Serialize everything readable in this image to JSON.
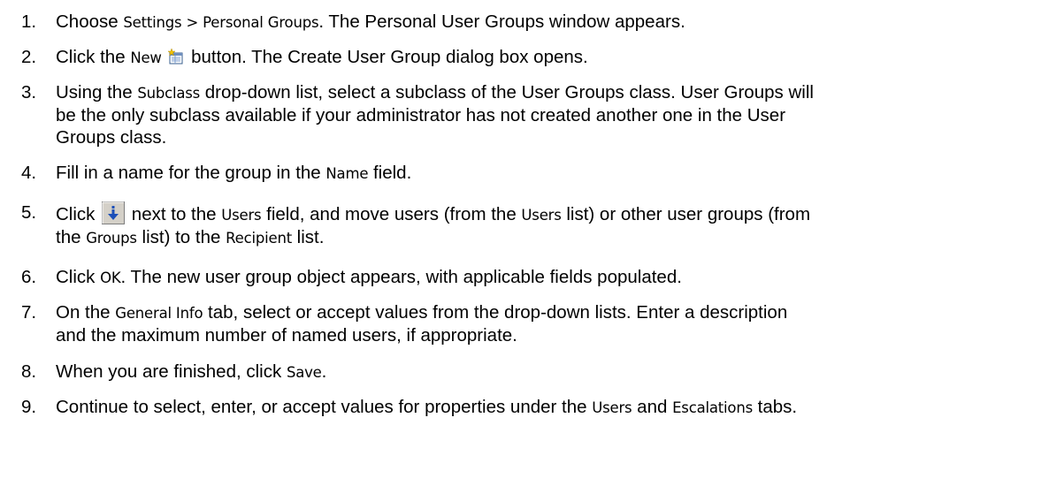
{
  "steps": [
    {
      "number": "1.",
      "parts": [
        {
          "t": "Choose "
        },
        {
          "t": "Settings > Personal Groups",
          "ui": true
        },
        {
          "t": ". The Personal User Groups window appears."
        }
      ]
    },
    {
      "number": "2.",
      "parts": [
        {
          "t": "Click the "
        },
        {
          "t": "New",
          "ui": true
        },
        {
          "t": " "
        },
        {
          "icon": "new-group-icon"
        },
        {
          "t": " button. The Create User Group dialog box opens."
        }
      ]
    },
    {
      "number": "3.",
      "parts": [
        {
          "t": "Using the "
        },
        {
          "t": "Subclass",
          "ui": true
        },
        {
          "t": " drop-down list, select a subclass of the User Groups class. User Groups will"
        },
        {
          "br": true
        },
        {
          "t": "be the only subclass available if your administrator has not created another one in the User"
        },
        {
          "br": true
        },
        {
          "t": "Groups class."
        }
      ]
    },
    {
      "number": "4.",
      "parts": [
        {
          "t": "Fill in a name for the group in the "
        },
        {
          "t": "Name",
          "ui": true
        },
        {
          "t": " field."
        }
      ]
    },
    {
      "number": "5.",
      "parts": [
        {
          "t": "Click "
        },
        {
          "icon": "move-down-arrow-icon"
        },
        {
          "t": " next to the "
        },
        {
          "t": "Users",
          "ui": true
        },
        {
          "t": " field, and move users (from the "
        },
        {
          "t": "Users",
          "ui": true
        },
        {
          "t": " list) or other user groups (from"
        },
        {
          "br": true
        },
        {
          "t": "the "
        },
        {
          "t": "Groups",
          "ui": true
        },
        {
          "t": " list) to the "
        },
        {
          "t": "Recipient",
          "ui": true
        },
        {
          "t": " list."
        }
      ]
    },
    {
      "number": "6.",
      "parts": [
        {
          "t": "Click "
        },
        {
          "t": "OK",
          "ui": true
        },
        {
          "t": ". The new user group object appears, with applicable fields populated."
        }
      ]
    },
    {
      "number": "7.",
      "parts": [
        {
          "t": "On the "
        },
        {
          "t": "General Info",
          "ui": true
        },
        {
          "t": " tab, select or accept values from the drop-down lists. Enter a description"
        },
        {
          "br": true
        },
        {
          "t": "and the maximum number of named users, if appropriate."
        }
      ]
    },
    {
      "number": "8.",
      "parts": [
        {
          "t": "When you are finished, click "
        },
        {
          "t": "Save",
          "ui": true
        },
        {
          "t": "."
        }
      ]
    },
    {
      "number": "9.",
      "parts": [
        {
          "t": "Continue to select, enter, or accept values for properties under the "
        },
        {
          "t": "Users",
          "ui": true
        },
        {
          "t": " and "
        },
        {
          "t": "Escalations",
          "ui": true
        },
        {
          "t": " tabs."
        }
      ]
    }
  ]
}
